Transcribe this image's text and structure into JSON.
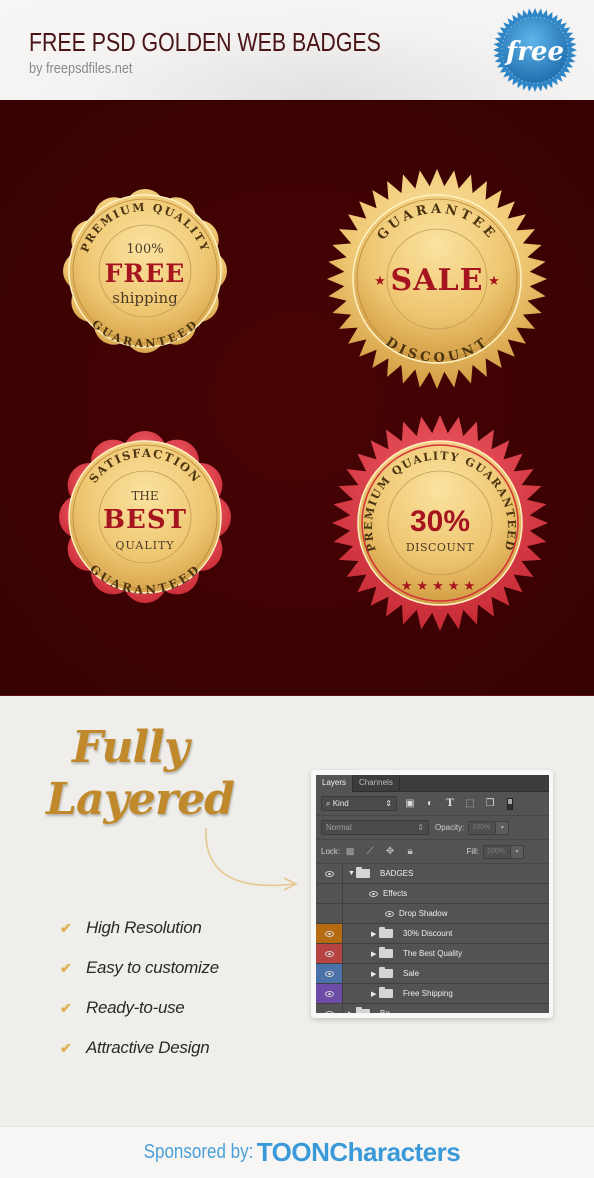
{
  "header": {
    "title": "FREE PSD GOLDEN WEB BADGES",
    "subtitle": "by freepsdfiles.net",
    "free_badge_label": "free"
  },
  "colors": {
    "title": "#4a1416",
    "showcase_bg": "#3c0203",
    "gold": "#e9c56c",
    "badge_red": "#b01d2b",
    "ribbon_red": "#d9363f",
    "script_gold": "#c08a2c",
    "check": "#e2b04e",
    "sponsor_blue": "#3a9ad9",
    "free_blue": "#2f86c6"
  },
  "badges": [
    {
      "name": "free-shipping",
      "top_arc": "PREMIUM QUALITY",
      "line1": "100%",
      "main": "FREE",
      "line2": "shipping",
      "bottom_arc": "GUARANTEED",
      "shape": "scalloped",
      "rim": "gold"
    },
    {
      "name": "sale",
      "top_arc": "GUARANTEE",
      "main": "SALE",
      "bottom_arc": "DISCOUNT",
      "stars": "★",
      "shape": "starburst",
      "rim": "gold"
    },
    {
      "name": "best-quality",
      "top_arc": "SATISFACTION",
      "line1": "THE",
      "main": "BEST",
      "line2": "QUALITY",
      "bottom_arc": "GUARANTEED",
      "shape": "scalloped",
      "rim": "red"
    },
    {
      "name": "thirty-discount",
      "arc": "PREMIUM QUALITY GUARANTEED",
      "main": "30%",
      "line2": "DISCOUNT",
      "stars": "★★★★★",
      "shape": "starburst",
      "rim": "red"
    }
  ],
  "features": {
    "headline_line1": "Fully",
    "headline_line2": "Layered",
    "check_glyph": "✔",
    "items": [
      "High Resolution",
      "Easy to customize",
      "Ready-to-use",
      "Attractive Design"
    ]
  },
  "layers_panel": {
    "tabs": [
      "Layers",
      "Channels"
    ],
    "filter_label": "Kind",
    "blend_mode": "Normal",
    "opacity_label": "Opacity:",
    "opacity_value": "100%",
    "lock_label": "Lock:",
    "fill_label": "Fill:",
    "fill_value": "100%",
    "layers": [
      {
        "name": "BADGES",
        "kind": "group-open",
        "indent": 0,
        "color": ""
      },
      {
        "name": "Effects",
        "kind": "effects",
        "indent": 1,
        "color": ""
      },
      {
        "name": "Drop Shadow",
        "kind": "effect",
        "indent": 2,
        "color": ""
      },
      {
        "name": "30% Discount",
        "kind": "group",
        "indent": 1,
        "color": "#b66a12"
      },
      {
        "name": "The Best Quality",
        "kind": "group",
        "indent": 1,
        "color": "#b84343"
      },
      {
        "name": "Sale",
        "kind": "group",
        "indent": 1,
        "color": "#4a72a8"
      },
      {
        "name": "Free Shipping",
        "kind": "group",
        "indent": 1,
        "color": "#6c4ca6"
      },
      {
        "name": "Bg",
        "kind": "group",
        "indent": 0,
        "color": ""
      }
    ]
  },
  "footer": {
    "sponsor_label": "Sponsored by:",
    "brand": "TOONCharacters"
  }
}
